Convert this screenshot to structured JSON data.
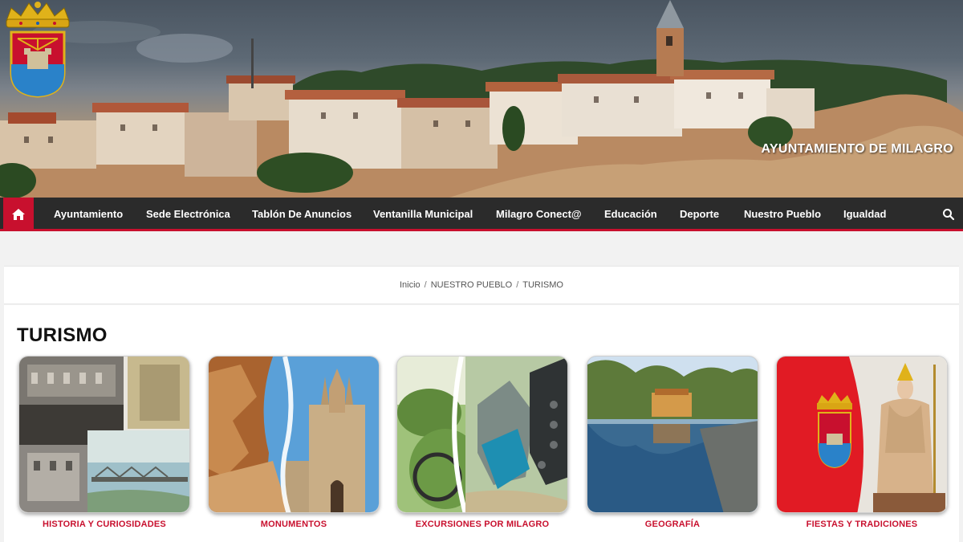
{
  "site": {
    "title": "AYUNTAMIENTO DE MILAGRO"
  },
  "nav": {
    "home_icon": "home-icon",
    "search_icon": "search-icon",
    "items": [
      {
        "label": "Ayuntamiento"
      },
      {
        "label": "Sede Electrónica"
      },
      {
        "label": "Tablón De Anuncios"
      },
      {
        "label": "Ventanilla Municipal"
      },
      {
        "label": "Milagro Conect@"
      },
      {
        "label": "Educación"
      },
      {
        "label": "Deporte"
      },
      {
        "label": "Nuestro Pueblo"
      },
      {
        "label": "Igualdad"
      }
    ]
  },
  "breadcrumb": {
    "items": [
      {
        "label": "Inicio"
      },
      {
        "label": "NUESTRO PUEBLO"
      },
      {
        "label": "TURISMO"
      }
    ],
    "separator": "/"
  },
  "page": {
    "title": "TURISMO",
    "cards": [
      {
        "label": "HISTORIA Y CURIOSIDADES"
      },
      {
        "label": "MONUMENTOS"
      },
      {
        "label": "EXCURSIONES POR MILAGRO"
      },
      {
        "label": "GEOGRAFÍA"
      },
      {
        "label": "FIESTAS Y TRADICIONES"
      }
    ]
  },
  "colors": {
    "accent": "#c8102e",
    "navbar": "#2b2b2b",
    "card_caption": "#c8102e"
  }
}
